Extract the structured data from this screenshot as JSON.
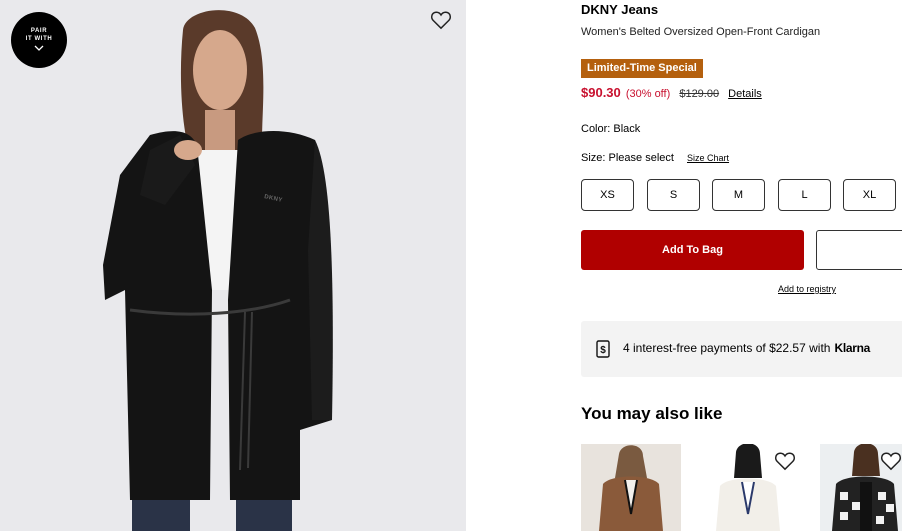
{
  "gallery": {
    "pair_badge": {
      "line1": "PAIR",
      "line2": "IT WITH",
      "icon": "chevron-down-icon"
    },
    "favorite_icon": "heart-icon",
    "image_alt": "Model wearing black belted oversized open-front cardigan",
    "chest_logo": "DKNY"
  },
  "product": {
    "brand": "DKNY Jeans",
    "name": "Women's Belted Oversized Open-Front Cardigan",
    "promo_badge": "Limited-Time Special",
    "sale_price": "$90.30",
    "discount": "(30% off)",
    "original_price": "$129.00",
    "details_link": "Details",
    "color_label": "Color: Black",
    "size_label": "Size: Please select",
    "size_chart_link": "Size Chart",
    "sizes": [
      "XS",
      "S",
      "M",
      "L",
      "XL"
    ],
    "add_to_bag": "Add To Bag",
    "add_to_registry": "Add to registry"
  },
  "klarna": {
    "icon": "dollar-receipt-icon",
    "text": "4 interest-free payments of $22.57 with",
    "brand": "Klarna"
  },
  "recommendations": {
    "title": "You may also like",
    "items": [
      {
        "name": "brown-cardigan",
        "color": "#8a5a3a"
      },
      {
        "name": "white-cardigan",
        "color": "#f2efe9"
      },
      {
        "name": "patterned-cardigan",
        "color": "#222222"
      }
    ]
  },
  "colors": {
    "brand_red": "#b00000",
    "sale_red": "#c8102e",
    "promo_orange": "#b4600e",
    "klarna_bg": "#f3f3f3"
  }
}
